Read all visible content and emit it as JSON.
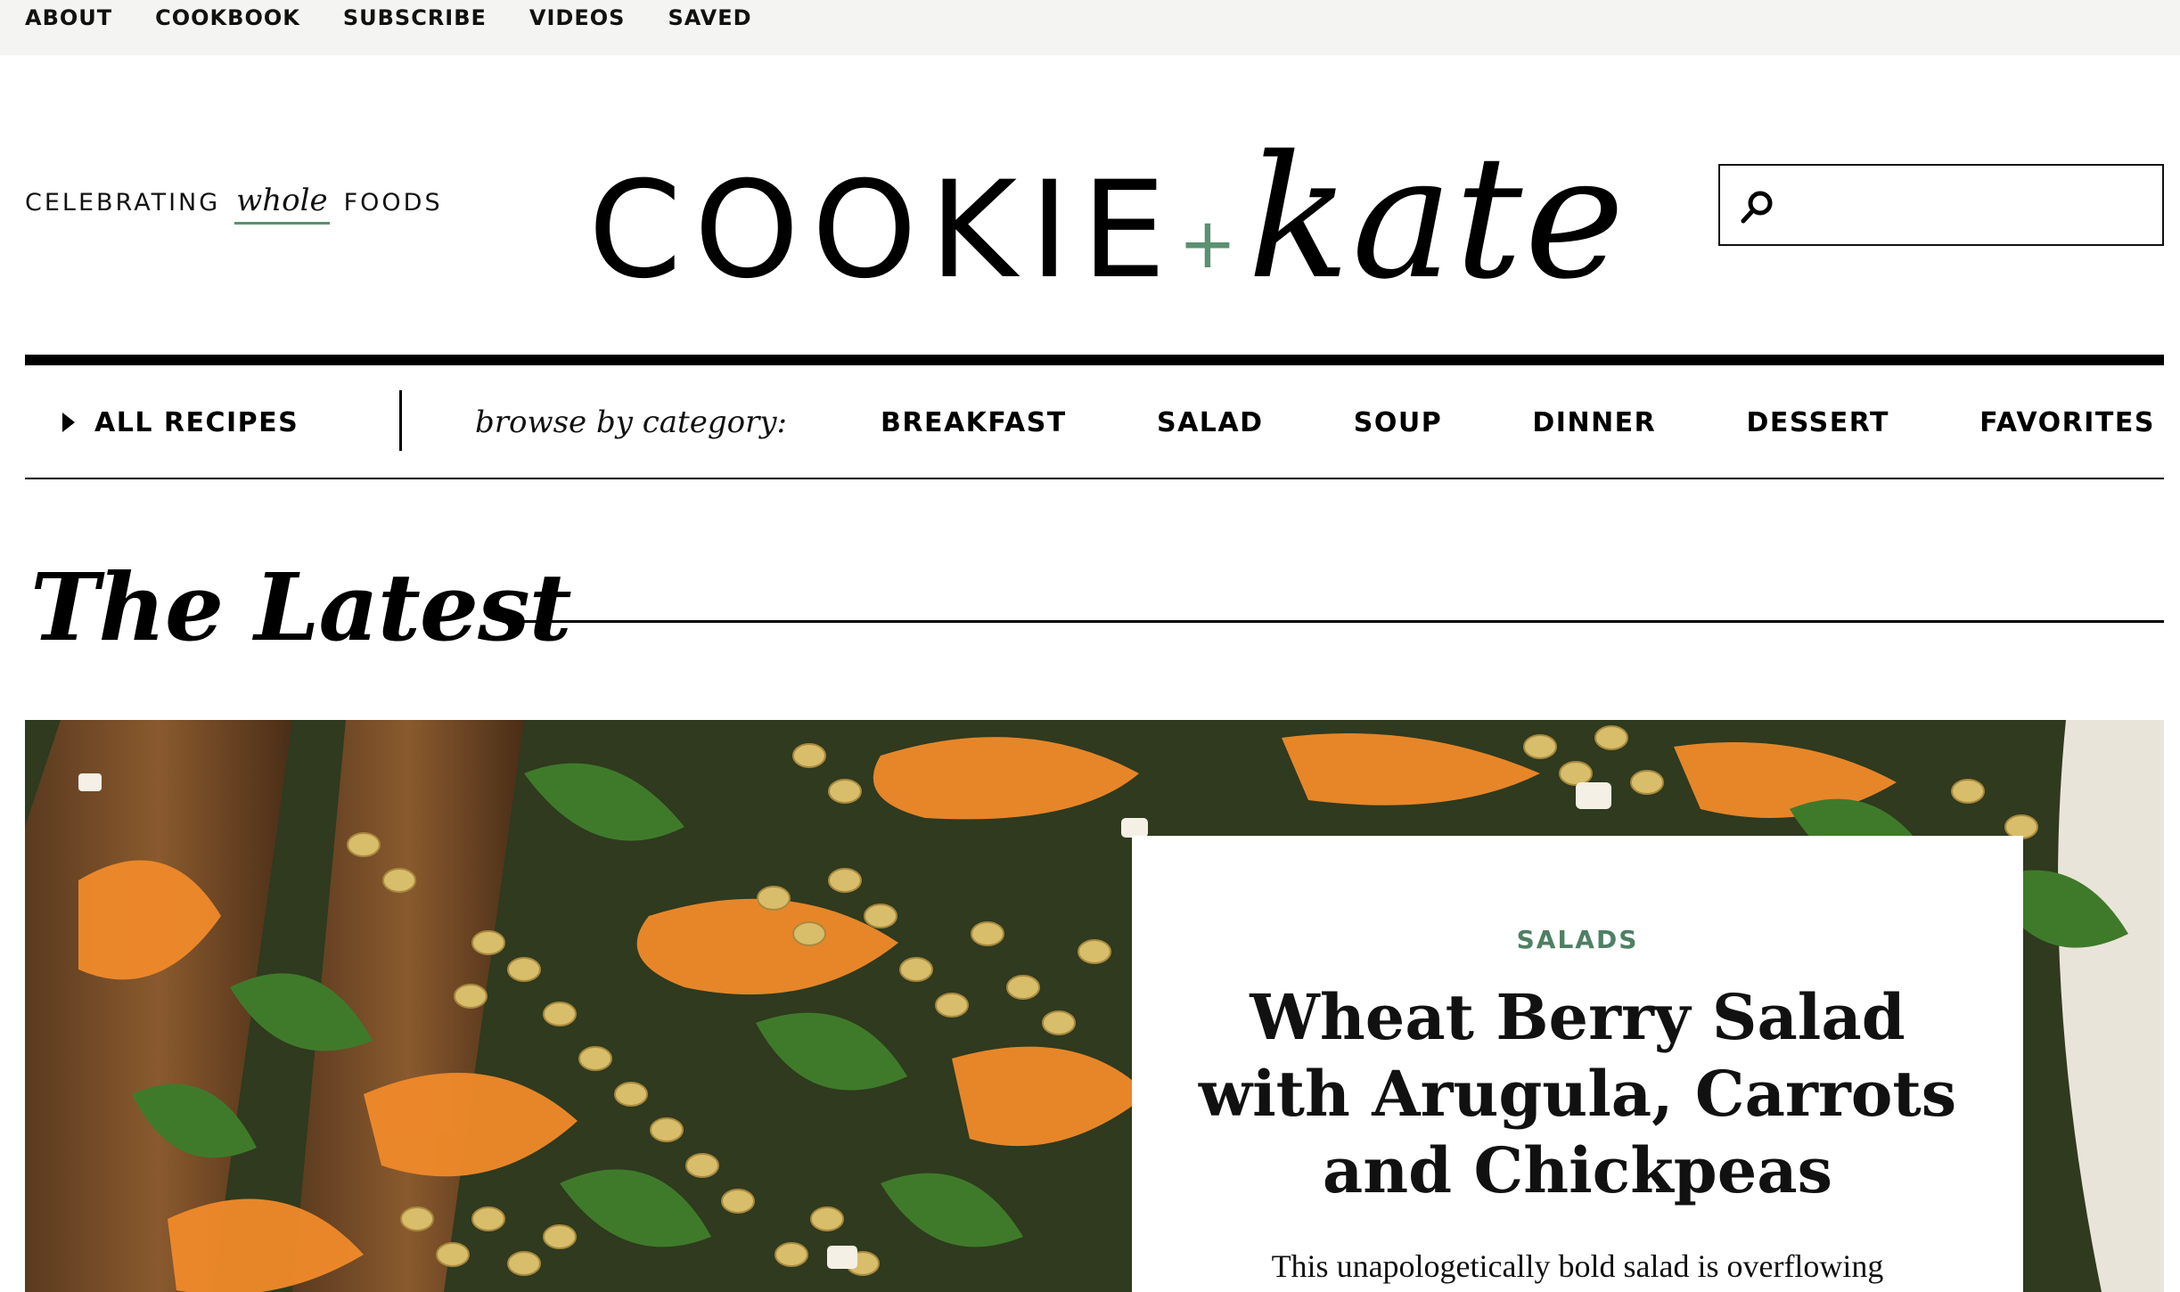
{
  "top_nav": [
    "ABOUT",
    "COOKBOOK",
    "SUBSCRIBE",
    "VIDEOS",
    "SAVED"
  ],
  "header": {
    "tagline_prefix": "CELEBRATING",
    "tagline_emphasis": "whole",
    "tagline_suffix": "FOODS",
    "logo_word": "COOKIE",
    "logo_plus": "+",
    "logo_script": "kate",
    "search_placeholder": "",
    "search_icon": "search-icon"
  },
  "category_nav": {
    "all_recipes_label": "ALL RECIPES",
    "browse_label": "browse by category:",
    "categories": [
      "BREAKFAST",
      "SALAD",
      "SOUP",
      "DINNER",
      "DESSERT",
      "FAVORITES"
    ]
  },
  "section": {
    "title": "The Latest"
  },
  "featured": {
    "kicker": "SALADS",
    "title": "Wheat Berry Salad with Arugula, Carrots and Chickpeas",
    "excerpt": "This unapologetically bold salad is overflowing"
  },
  "colors": {
    "accent_green": "#5a9170",
    "kicker_green": "#4f8064",
    "topbar_bg": "#f4f4f2",
    "text": "#111111"
  }
}
